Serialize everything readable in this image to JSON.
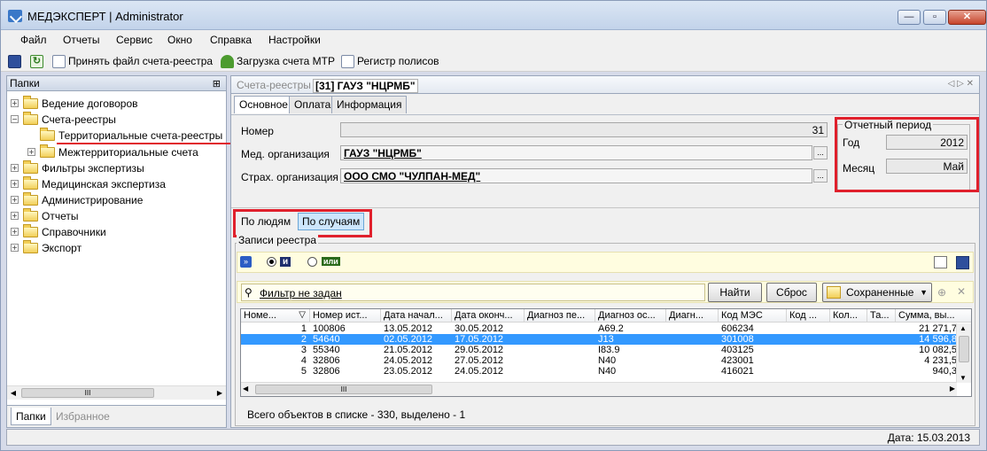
{
  "window": {
    "title": "МЕДЭКСПЕРТ | Administrator",
    "minimize": "—",
    "maximize": "▫",
    "close": "✕"
  },
  "menu": [
    "Файл",
    "Отчеты",
    "Сервис",
    "Окно",
    "Справка",
    "Настройки"
  ],
  "toolbar": {
    "accept": "Принять файл счета-реестра",
    "load_mtr": "Загрузка счета МТР",
    "registry": "Регистр полисов"
  },
  "folders_panel": {
    "title": "Папки",
    "pin": "⊞",
    "tree": [
      {
        "label": "Ведение договоров",
        "toggle": "+"
      },
      {
        "label": "Счета-реестры",
        "toggle": "−"
      },
      {
        "label": "Территориальные счета-реестры",
        "toggle": ""
      },
      {
        "label": "Межтерриториальные счета",
        "toggle": "+"
      },
      {
        "label": "Фильтры экспертизы",
        "toggle": "+"
      },
      {
        "label": "Медицинская экспертиза",
        "toggle": "+"
      },
      {
        "label": "Администрирование",
        "toggle": "+"
      },
      {
        "label": "Отчеты",
        "toggle": "+"
      },
      {
        "label": "Справочники",
        "toggle": "+"
      },
      {
        "label": "Экспорт",
        "toggle": "+"
      }
    ],
    "scroll_grip": "III",
    "tabs": [
      "Папки",
      "Избранное"
    ]
  },
  "document": {
    "breadcrumb": "Счета-реестры",
    "title": "[31] ГАУЗ \"НЦРМБ\"",
    "nav": "◁ ▷ ✕",
    "tabs": [
      "Основное",
      "Оплата",
      "Информация"
    ],
    "form": {
      "number_label": "Номер",
      "number_value": "31",
      "med_org_label": "Мед. организация",
      "med_org_value": "ГАУЗ \"НЦРМБ\"",
      "ins_org_label": "Страх. организация",
      "ins_org_value": "ООО СМО \"ЧУЛПАН-МЕД\"",
      "ellipsis": "..."
    },
    "period": {
      "title": "Отчетный период",
      "year_label": "Год",
      "year_value": "2012",
      "month_label": "Месяц",
      "month_value": "Май"
    },
    "mode_buttons": [
      "По людям",
      "По случаям"
    ],
    "records": {
      "title": "Записи реестра",
      "and_label": "и",
      "or_label": "или",
      "filter_text": "Фильтр не задан",
      "find_button": "Найти",
      "reset_button": "Сброс",
      "saved_button": "Сохраненные",
      "columns": [
        "Номе...",
        "Номер ист...",
        "Дата начал...",
        "Дата оконч...",
        "Диагноз пе...",
        "Диагноз ос...",
        "Диагн...",
        "Код МЭС",
        "Код ...",
        "Кол...",
        "Та...",
        "Сумма, вы..."
      ],
      "rows": [
        {
          "n": "1",
          "hist": "100806",
          "start": "13.05.2012",
          "end": "30.05.2012",
          "diag1": "",
          "diag2": "A69.2",
          "diag3": "",
          "mes": "606234",
          "code": "",
          "qty": "",
          "ta": "",
          "sum": "21 271,7"
        },
        {
          "n": "2",
          "hist": "54640",
          "start": "02.05.2012",
          "end": "17.05.2012",
          "diag1": "",
          "diag2": "J13",
          "diag3": "",
          "mes": "301008",
          "code": "",
          "qty": "",
          "ta": "",
          "sum": "14 596,8"
        },
        {
          "n": "3",
          "hist": "55340",
          "start": "21.05.2012",
          "end": "29.05.2012",
          "diag1": "",
          "diag2": "I83.9",
          "diag3": "",
          "mes": "403125",
          "code": "",
          "qty": "",
          "ta": "",
          "sum": "10 082,5"
        },
        {
          "n": "4",
          "hist": "32806",
          "start": "24.05.2012",
          "end": "27.05.2012",
          "diag1": "",
          "diag2": "N40",
          "diag3": "",
          "mes": "423001",
          "code": "",
          "qty": "",
          "ta": "",
          "sum": "4 231,5"
        },
        {
          "n": "5",
          "hist": "32806",
          "start": "23.05.2012",
          "end": "24.05.2012",
          "diag1": "",
          "diag2": "N40",
          "diag3": "",
          "mes": "416021",
          "code": "",
          "qty": "",
          "ta": "",
          "sum": "940,3"
        }
      ],
      "selected_row": 1,
      "grid_scroll_grip": "III",
      "footer": "Всего объектов в списке - 330, выделено - 1"
    }
  },
  "status": {
    "date": "Дата: 15.03.2013"
  }
}
